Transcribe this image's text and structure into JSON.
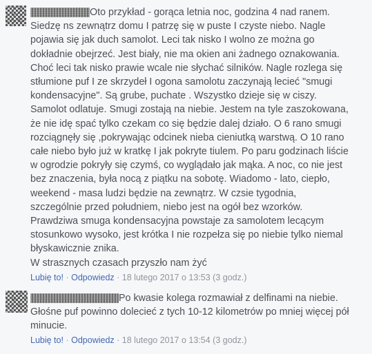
{
  "comments": [
    {
      "author_redacted": true,
      "text": "Oto przykład - gorąca letnia noc, godzina 4 nad ranem.\nSiedzę ns zewnątrz domu I patrzę się w puste I czyste niebo. Nagle\npojawia się jak duch samolot. Leci tak nisko I wolno ze można go\ndokładnie obejrzeć. Jest biały, nie ma okien ani żadnego oznakowania.\nChoć leci tak nisko prawie wcale nie słychać silników. Nagle rozlega się\nstłumione puf I ze skrzydeł I ogona samolotu zaczynają lecieć \"smugi\nkondensacyjne\". Są grube, puchate . Wszystko dzieje się w ciszy.\nSamolot odlatuje. Smugi zostają na niebie. Jestem na tyle zaszokowana,\nże nie idę spać tylko czekam co się będzie dalej działo. O 6 rano smugi\nrozciągnęły się ,pokrywając odcinek nieba cieniutką warstwą. O 10 rano\ncałe niebo było już w kratkę I jak pokryte tiulem. Po paru godzinach liście\nw ogrodzie pokryły się czymś, co wyglądało jak mąka. A noc, co nie jest\nbez znaczenia, była nocą z piątku na sobotę. Wiadomo - lato, ciepło,\nweekend - masa ludzi będzie na zewnątrz. W czsie tygodnia,\nszczególnie przed południem, niebo jest na ogół bez wzorków.\nPrawdziwa smuga kondensacyjna powstaje za samolotem lecącym\nstosunkowo wysoko, jest krótka I nie rozpełza się po niebie tylko niemal\nbłyskawicznie znika.\nW strasznych czasach przyszło nam żyć",
      "like_label": "Lubię to!",
      "reply_label": "Odpowiedz",
      "timestamp": "18 lutego 2017 o 13:53 (3 godz.)",
      "separator": "·"
    },
    {
      "author_redacted": true,
      "text": "Po kwasie kolega rozmawiał z delfinami na niebie.\nGłośne puf powinno dolecieć z tych 10-12 kilometrów po mniej więcej pół\nminucie.",
      "like_label": "Lubię to!",
      "reply_label": "Odpowiedz",
      "timestamp": "18 lutego 2017 o 13:54 (3 godz.)",
      "separator": "·"
    }
  ]
}
